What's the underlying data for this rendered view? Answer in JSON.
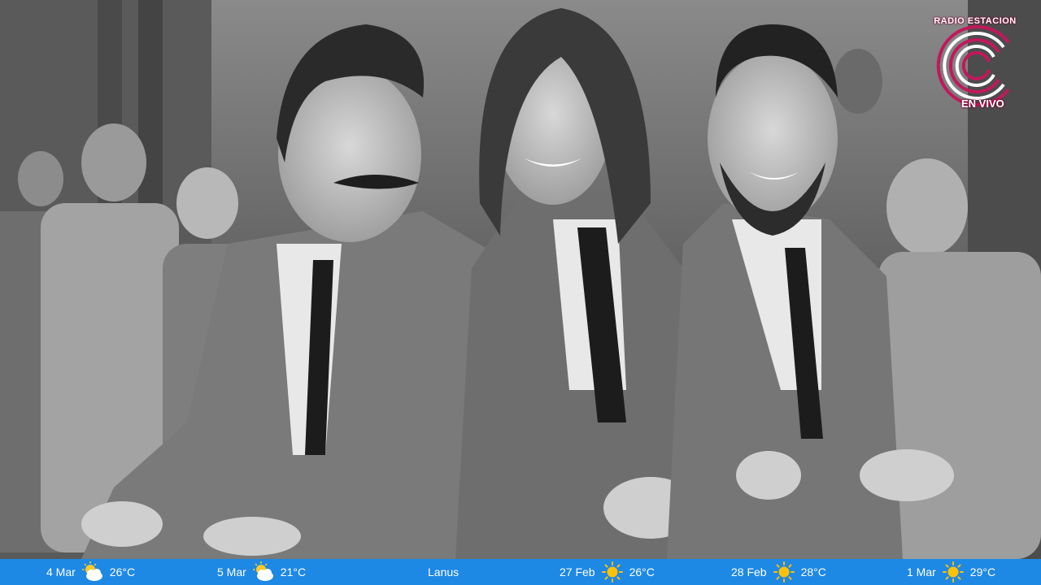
{
  "logo": {
    "name_top": "RADIO ESTACION",
    "name_bottom": "EN VIVO",
    "colors": [
      "#c2185b",
      "#ffffff"
    ]
  },
  "ticker": {
    "background": "#1e88e5",
    "items": [
      {
        "date": "4 Mar",
        "icon": "partly-cloudy-icon",
        "temp": "26°C"
      },
      {
        "date": "5 Mar",
        "icon": "partly-cloudy-icon",
        "temp": "21°C"
      },
      {
        "city": "Lanus"
      },
      {
        "date": "27 Feb",
        "icon": "sun-icon",
        "temp": "26°C"
      },
      {
        "date": "28 Feb",
        "icon": "sun-icon",
        "temp": "28°C"
      },
      {
        "date": "1 Mar",
        "icon": "sun-icon",
        "temp": "29°C"
      }
    ]
  }
}
